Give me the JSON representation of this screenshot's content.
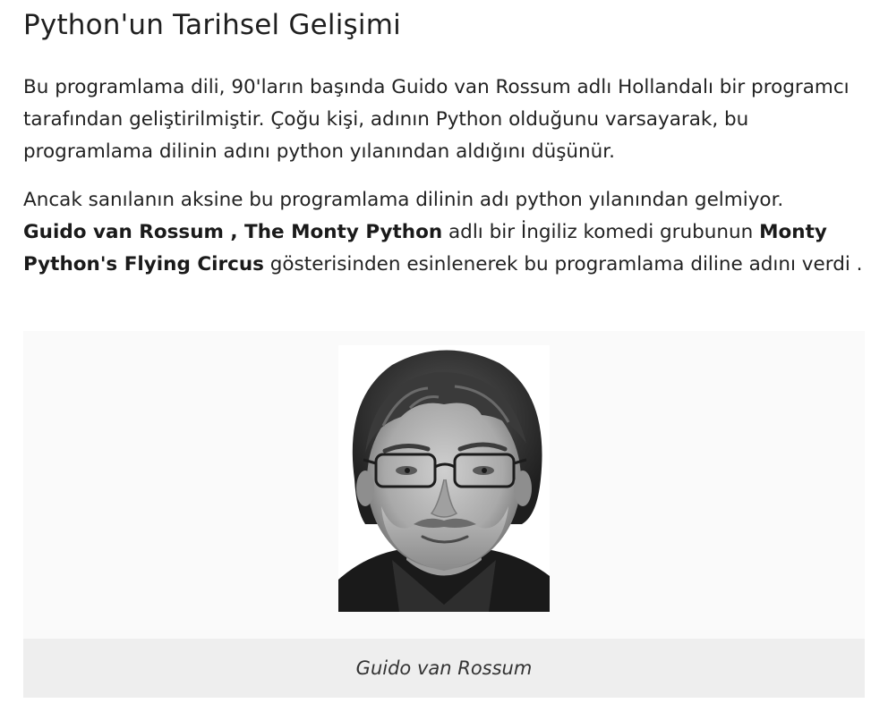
{
  "article": {
    "title": "Python'un Tarihsel Gelişimi",
    "paragraph1": "Bu programlama dili, 90'ların başında Guido van Rossum adlı Hollandalı bir programcı tarafından geliştirilmiştir. Çoğu kişi, adının Python olduğunu varsayarak, bu programlama dilinin adını python yılanından aldığını düşünür.",
    "paragraph2": {
      "line1": "Ancak sanılanın aksine bu programlama dilinin adı python yılanından gelmiyor.",
      "bold1": "Guido van Rossum , The Monty Python",
      "text1": " adlı bir İngiliz komedi grubunun ",
      "bold2": "Monty Python's Flying Circus",
      "text2": " gösterisinden esinlenerek bu programlama diline adını verdi ."
    }
  },
  "figure": {
    "caption": "Guido van Rossum",
    "photo_icon": "portrait-photo"
  },
  "colors": {
    "text": "#222222",
    "figure_background": "#fafafa",
    "caption_background": "#eeeeee"
  }
}
